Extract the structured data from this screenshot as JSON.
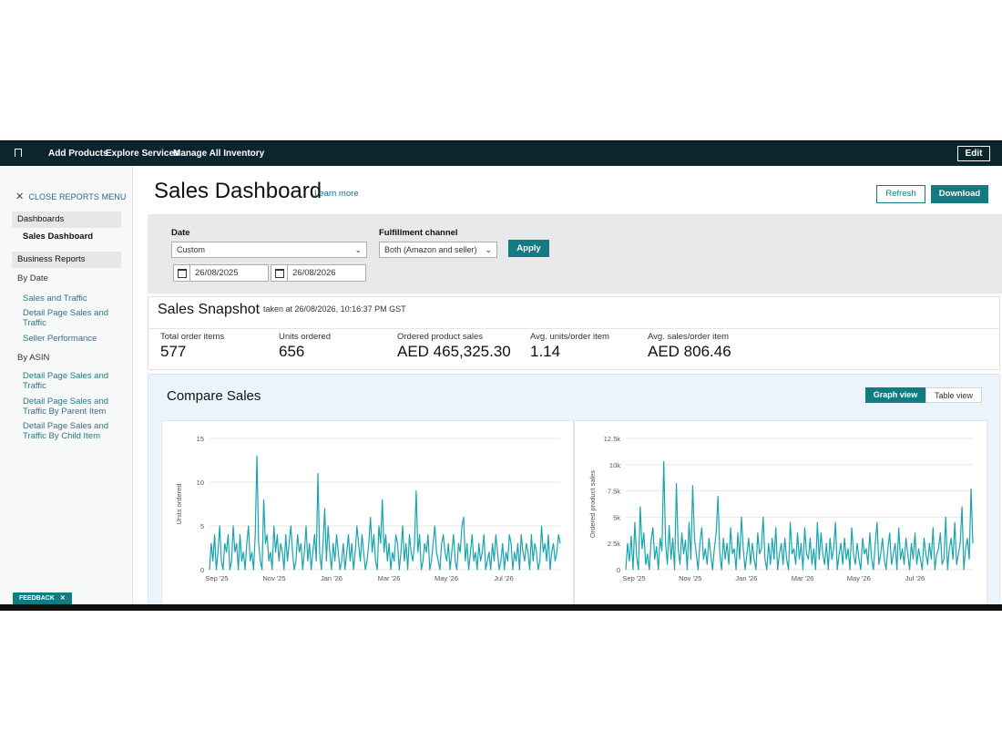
{
  "topbar": {
    "nav": [
      {
        "label": "Add Products"
      },
      {
        "label": "Explore Services"
      },
      {
        "label": "Manage All Inventory"
      }
    ],
    "edit_label": "Edit"
  },
  "sidebar": {
    "close_label": "CLOSE REPORTS MENU",
    "dashboards_label": "Dashboards",
    "sales_dashboard": "Sales Dashboard",
    "business_reports_label": "Business Reports",
    "by_date_label": "By Date",
    "by_date_items": [
      "Sales and Traffic",
      "Detail Page Sales and Traffic",
      "Seller Performance"
    ],
    "by_asin_label": "By ASIN",
    "by_asin_items": [
      "Detail Page Sales and Traffic",
      "Detail Page Sales and Traffic By Parent Item",
      "Detail Page Sales and Traffic By Child Item"
    ],
    "feedback_label": "FEEDBACK"
  },
  "header": {
    "title": "Sales Dashboard",
    "learn_more": "Learn more",
    "refresh_label": "Refresh",
    "download_label": "Download"
  },
  "filters": {
    "date_label": "Date",
    "date_select": "Custom",
    "start_date": "26/08/2025",
    "end_date": "26/08/2026",
    "channel_label": "Fulfillment channel",
    "channel_select": "Both (Amazon and seller)",
    "apply_label": "Apply"
  },
  "snapshot": {
    "title": "Sales Snapshot",
    "taken": "taken at 26/08/2026, 10:16:37 PM GST",
    "metrics": [
      {
        "label": "Total order items",
        "value": "577"
      },
      {
        "label": "Units ordered",
        "value": "656"
      },
      {
        "label": "Ordered product sales",
        "value": "AED 465,325.30"
      },
      {
        "label": "Avg. units/order item",
        "value": "1.14"
      },
      {
        "label": "Avg. sales/order item",
        "value": "AED 806.46"
      }
    ]
  },
  "compare": {
    "title": "Compare Sales",
    "graph_view": "Graph view",
    "table_view": "Table view"
  },
  "colors": {
    "accent": "#127c82",
    "line": "#17a5ad",
    "topbar": "#0b252f"
  },
  "chart_data": [
    {
      "type": "line",
      "title": "",
      "xlabel": "",
      "ylabel": "Units ordered",
      "ylim": [
        0,
        15
      ],
      "yticks": [
        "0",
        "5",
        "10",
        "15"
      ],
      "xticks": [
        "Sep '25",
        "Nov '25",
        "Jan '26",
        "Mar '26",
        "May '26",
        "Jul '26"
      ],
      "grid": true,
      "series": [
        {
          "values": [
            0,
            3,
            1,
            4,
            0,
            2,
            5,
            1,
            0,
            3,
            2,
            4,
            0,
            1,
            5,
            2,
            3,
            0,
            4,
            1,
            2,
            0,
            3,
            5,
            1,
            2,
            0,
            4,
            13,
            3,
            1,
            0,
            8,
            3,
            4,
            1,
            2,
            0,
            5,
            2,
            4,
            1,
            3,
            2,
            0,
            4,
            1,
            3,
            5,
            2,
            0,
            1,
            4,
            2,
            3,
            0,
            2,
            5,
            1,
            3,
            0,
            2,
            4,
            1,
            11,
            2,
            0,
            3,
            7,
            1,
            5,
            2,
            0,
            3,
            1,
            4,
            2,
            0,
            1,
            3,
            0,
            2,
            4,
            1,
            3,
            0,
            2,
            5,
            3,
            1,
            4,
            2,
            0,
            1,
            3,
            6,
            2,
            4,
            1,
            0,
            5,
            3,
            8,
            2,
            4,
            1,
            3,
            0,
            2,
            1,
            4,
            3,
            0,
            2,
            5,
            1,
            3,
            0,
            4,
            2,
            1,
            3,
            9,
            2,
            4,
            0,
            1,
            3,
            2,
            4,
            0,
            1,
            3,
            5,
            2,
            1,
            0,
            3,
            4,
            2,
            1,
            3,
            0,
            2,
            4,
            1,
            0,
            3,
            2,
            5,
            6,
            1,
            3,
            0,
            2,
            4,
            1,
            2,
            0,
            3,
            1,
            2,
            4,
            0,
            1,
            2,
            0,
            3,
            1,
            4,
            2,
            0,
            1,
            3,
            0,
            2,
            1,
            4,
            3,
            0,
            2,
            1,
            3,
            0,
            4,
            2,
            1,
            3,
            2,
            0,
            4,
            1,
            3,
            2,
            0,
            1,
            5,
            2,
            3,
            1,
            4,
            0,
            2,
            3,
            1,
            2,
            4,
            3
          ]
        }
      ]
    },
    {
      "type": "line",
      "title": "",
      "xlabel": "",
      "ylabel": "Ordered product sales",
      "ylim": [
        0,
        12500
      ],
      "yticks": [
        "0",
        "2.5k",
        "5k",
        "7.5k",
        "10k",
        "12.5k"
      ],
      "xticks": [
        "Sep '25",
        "Nov '25",
        "Jan '26",
        "Mar '26",
        "May '26",
        "Jul '26"
      ],
      "grid": true,
      "series": [
        {
          "values": [
            0,
            2500,
            800,
            3200,
            0,
            4500,
            1200,
            0,
            6000,
            2000,
            3500,
            500,
            1500,
            0,
            2800,
            4000,
            1000,
            2200,
            0,
            3000,
            1800,
            10300,
            2500,
            500,
            4200,
            1000,
            3000,
            0,
            8200,
            2000,
            500,
            3500,
            1500,
            2800,
            0,
            4500,
            1000,
            8000,
            3000,
            1500,
            0,
            2500,
            4000,
            1000,
            2000,
            500,
            3000,
            1500,
            0,
            2000,
            3500,
            7000,
            1500,
            0,
            3000,
            1000,
            2500,
            500,
            4000,
            1500,
            2000,
            0,
            3500,
            1000,
            5000,
            2000,
            0,
            1500,
            3000,
            500,
            2500,
            1000,
            0,
            3500,
            1500,
            2000,
            5000,
            1000,
            0,
            2500,
            500,
            3000,
            1000,
            4000,
            0,
            1500,
            2500,
            500,
            3000,
            1000,
            0,
            4500,
            1500,
            2000,
            500,
            3500,
            1000,
            2500,
            0,
            4000,
            1500,
            1000,
            3000,
            500,
            2000,
            0,
            4500,
            1000,
            3500,
            1500,
            500,
            2500,
            0,
            3000,
            1000,
            2000,
            4500,
            0,
            1500,
            2500,
            500,
            3000,
            1000,
            2000,
            0,
            4000,
            1500,
            500,
            2500,
            1000,
            0,
            3000,
            1500,
            2000,
            500,
            3500,
            1000,
            0,
            2500,
            4500,
            500,
            1500,
            3000,
            1000,
            0,
            2000,
            3500,
            500,
            1500,
            2500,
            0,
            4000,
            1000,
            2000,
            500,
            3000,
            1500,
            0,
            2500,
            1000,
            3500,
            500,
            2000,
            1000,
            0,
            3000,
            1500,
            500,
            2500,
            1000,
            4000,
            0,
            1500,
            2000,
            3500,
            500,
            1000,
            5000,
            0,
            2000,
            3000,
            1000,
            4500,
            500,
            1500,
            2500,
            6000,
            0,
            2000,
            3000,
            1000,
            7700,
            2500
          ]
        }
      ]
    }
  ]
}
